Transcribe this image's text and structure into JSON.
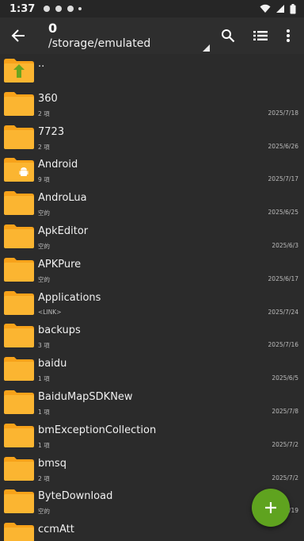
{
  "status": {
    "time": "1:37"
  },
  "toolbar": {
    "count": "0",
    "path": "/storage/emulated"
  },
  "colors": {
    "folder": "#fbb531",
    "folder_tab": "#f7a21a",
    "fab": "#5fa31f",
    "up_arrow": "#6aa51f"
  },
  "icons": [
    "back-arrow-icon",
    "search-icon",
    "list-view-icon",
    "more-vert-icon",
    "plus-icon",
    "android-badge-icon"
  ],
  "parent": {
    "label": ".."
  },
  "files": [
    {
      "name": "360",
      "meta": "2 項",
      "date": "2025/7/18"
    },
    {
      "name": "7723",
      "meta": "2 項",
      "date": "2025/6/26"
    },
    {
      "name": "Android",
      "meta": "9 項",
      "date": "2025/7/17"
    },
    {
      "name": "AndroLua",
      "meta": "空的",
      "date": "2025/6/25"
    },
    {
      "name": "ApkEditor",
      "meta": "空的",
      "date": "2025/6/3"
    },
    {
      "name": "APKPure",
      "meta": "空的",
      "date": "2025/6/17"
    },
    {
      "name": "Applications",
      "meta": "<LINK>",
      "date": "2025/7/24"
    },
    {
      "name": "backups",
      "meta": "3 項",
      "date": "2025/7/16"
    },
    {
      "name": "baidu",
      "meta": "1 項",
      "date": "2025/6/5"
    },
    {
      "name": "BaiduMapSDKNew",
      "meta": "1 項",
      "date": "2025/7/8"
    },
    {
      "name": "bmExceptionCollection",
      "meta": "1 項",
      "date": "2025/7/2"
    },
    {
      "name": "bmsq",
      "meta": "2 項",
      "date": "2025/7/2"
    },
    {
      "name": "ByteDownload",
      "meta": "空的",
      "date": "2025/6/19"
    },
    {
      "name": "ccmAtt",
      "meta": "",
      "date": ""
    }
  ]
}
